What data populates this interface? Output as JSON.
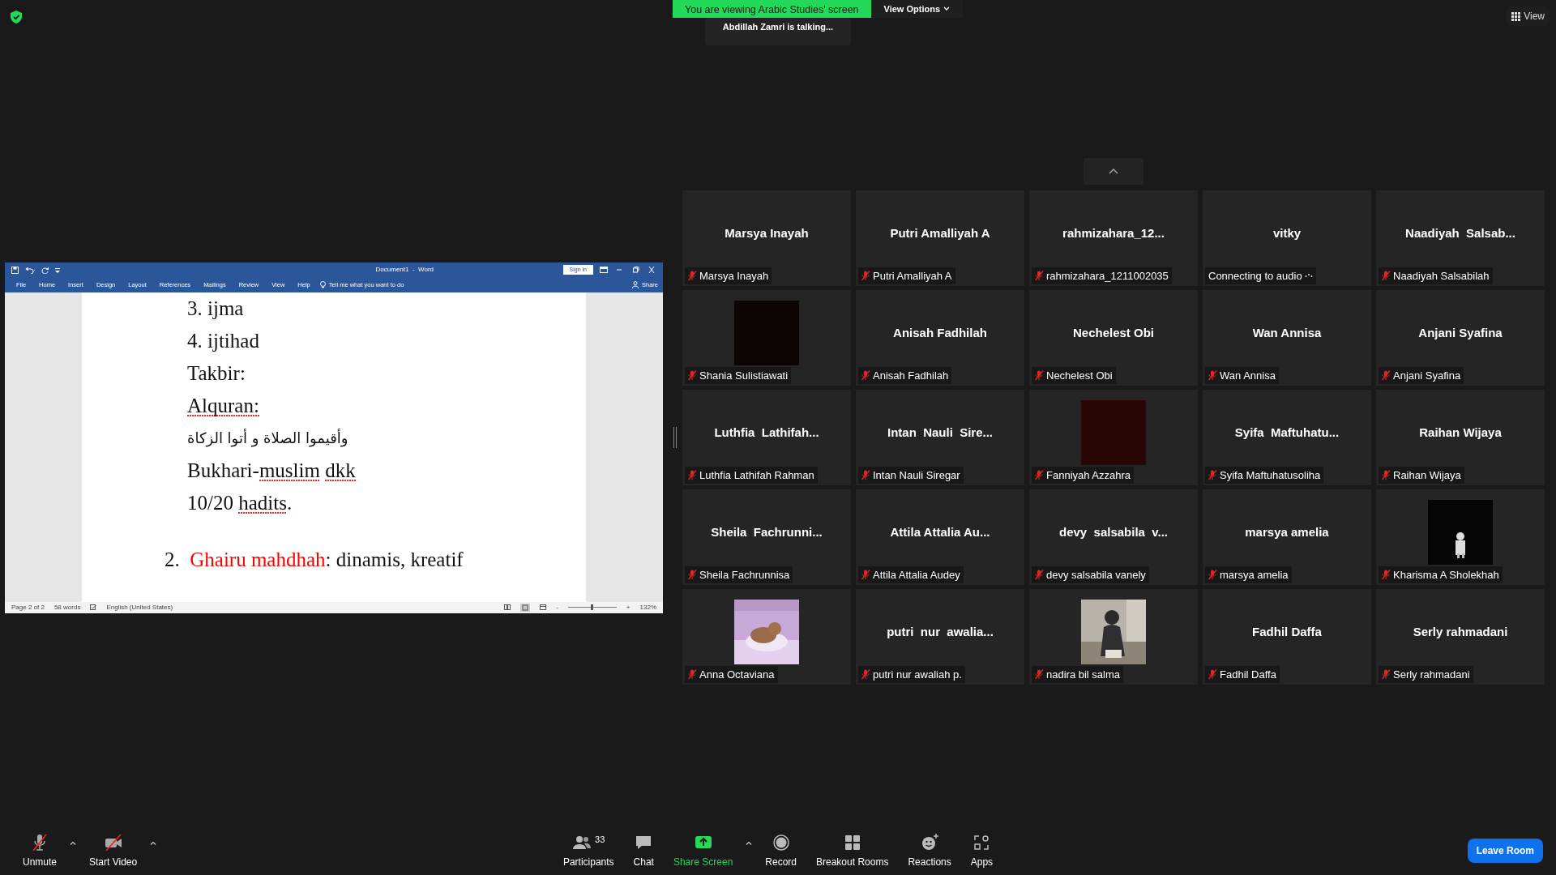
{
  "banner": {
    "text": "You are viewing Arabic Studies' screen",
    "view_options": "View Options"
  },
  "talking": "Abdillah Zamri is talking...",
  "view_button": "View",
  "word": {
    "title": "Document1  -  Word",
    "sign_in": "Sign in",
    "tabs": [
      "File",
      "Home",
      "Insert",
      "Design",
      "Layout",
      "References",
      "Mailings",
      "Review",
      "View",
      "Help"
    ],
    "tell_me": "Tell me what you want to do",
    "share": "Share",
    "lines": [
      {
        "runs": [
          {
            "text": "3. ijma",
            "misspelled": false
          }
        ]
      },
      {
        "runs": [
          {
            "text": "4. ijtihad",
            "misspelled": false
          }
        ]
      },
      {
        "runs": [
          {
            "text": "Takbir:",
            "misspelled": false
          }
        ]
      },
      {
        "runs": [
          {
            "text": "Alquran:",
            "misspelled": true
          }
        ]
      },
      {
        "kind": "arabic",
        "runs": [
          {
            "text": "وأقيموا الصلاة و أتوا الزكاة",
            "misspelled": false
          }
        ]
      },
      {
        "runs": [
          {
            "text": "Bukhari-",
            "misspelled": false
          },
          {
            "text": "muslim",
            "misspelled": true
          },
          {
            "text": " dkk",
            "misspelled": true
          }
        ]
      },
      {
        "runs": [
          {
            "text": "10/20 ",
            "misspelled": false
          },
          {
            "text": "hadits",
            "misspelled": true
          },
          {
            "text": ".",
            "misspelled": false
          }
        ]
      },
      {
        "gap_before": true,
        "runs": [
          {
            "text": "2.  ",
            "misspelled": false
          },
          {
            "text": "Ghairu mahdhah",
            "misspelled": false,
            "color": "#ff0000"
          },
          {
            "text": ": dinamis, kreatif",
            "misspelled": false
          }
        ]
      }
    ],
    "status": {
      "page": "Page 2 of 2",
      "words": "58 words",
      "language": "English (United States)",
      "zoom_minus": "-",
      "zoom_plus": "+",
      "zoom": "132%",
      "level": 0.5
    }
  },
  "tiles": [
    {
      "kind": "name",
      "display_name": "Marsya Inayah",
      "label": "Marsya Inayah",
      "muted": true
    },
    {
      "kind": "name",
      "display_name": "Putri Amalliyah A",
      "label": "Putri Amalliyah A",
      "muted": true
    },
    {
      "kind": "name",
      "display_name": "rahmizahara_12...",
      "label": "rahmizahara_1211002035",
      "muted": true
    },
    {
      "kind": "name",
      "display_name": "vitky",
      "label": "Connecting to audio",
      "muted": false,
      "connecting": true
    },
    {
      "kind": "name",
      "display_name": "Naadiyah  Salsab...",
      "label": "Naadiyah Salsabilah",
      "muted": true
    },
    {
      "kind": "video",
      "color": "#0d0404",
      "label": "Shania Sulistiawati",
      "muted": true
    },
    {
      "kind": "name",
      "display_name": "Anisah Fadhilah",
      "label": "Anisah Fadhilah",
      "muted": true
    },
    {
      "kind": "name",
      "display_name": "Nechelest Obi",
      "label": "Nechelest Obi",
      "muted": true
    },
    {
      "kind": "name",
      "display_name": "Wan Annisa",
      "label": "Wan Annisa",
      "muted": true
    },
    {
      "kind": "name",
      "display_name": "Anjani Syafina",
      "label": "Anjani Syafina",
      "muted": true
    },
    {
      "kind": "name",
      "display_name": "Luthfia  Lathifah...",
      "label": "Luthfia Lathifah Rahman",
      "muted": true
    },
    {
      "kind": "name",
      "display_name": "Intan  Nauli  Sire...",
      "label": "Intan Nauli Siregar",
      "muted": true
    },
    {
      "kind": "video",
      "color": "#2a0707",
      "label": "Fanniyah Azzahra",
      "muted": true
    },
    {
      "kind": "name",
      "display_name": "Syifa  Maftuhatu...",
      "label": "Syifa Maftuhatusoliha",
      "muted": true
    },
    {
      "kind": "name",
      "display_name": "Raihan Wijaya",
      "label": "Raihan Wijaya",
      "muted": true
    },
    {
      "kind": "name",
      "display_name": "Sheila  Fachrunni...",
      "label": "Sheila Fachrunnisa",
      "muted": true
    },
    {
      "kind": "name",
      "display_name": "Attila Attalia Au...",
      "label": "Attila Attalia Audey",
      "muted": true
    },
    {
      "kind": "name",
      "display_name": "devy  salsabila  v...",
      "label": "devy salsabila vanely",
      "muted": true
    },
    {
      "kind": "name",
      "display_name": "marsya amelia",
      "label": "marsya amelia",
      "muted": true
    },
    {
      "kind": "picture",
      "label": "Kharisma A Sholekhah",
      "muted": true
    },
    {
      "kind": "picture",
      "label": "Anna Octaviana",
      "muted": true
    },
    {
      "kind": "name",
      "display_name": "putri  nur  awalia...",
      "label": "putri nur awaliah p.",
      "muted": true
    },
    {
      "kind": "picture",
      "label": "nadira bil salma",
      "muted": true
    },
    {
      "kind": "name",
      "display_name": "Fadhil Daffa",
      "label": "Fadhil Daffa",
      "muted": true
    },
    {
      "kind": "name",
      "display_name": "Serly rahmadani",
      "label": "Serly rahmadani",
      "muted": true
    }
  ],
  "toolbar": {
    "left": [
      {
        "kind": "mic",
        "label": "Unmute"
      },
      {
        "kind": "camera",
        "label": "Start Video"
      }
    ],
    "center": [
      {
        "kind": "participants",
        "label": "Participants",
        "count": "33"
      },
      {
        "kind": "chat",
        "label": "Chat"
      },
      {
        "kind": "share",
        "label": "Share Screen"
      },
      {
        "kind": "record",
        "label": "Record"
      },
      {
        "kind": "breakout",
        "label": "Breakout Rooms"
      },
      {
        "kind": "reactions",
        "label": "Reactions"
      },
      {
        "kind": "apps",
        "label": "Apps"
      }
    ],
    "leave": "Leave Room"
  }
}
